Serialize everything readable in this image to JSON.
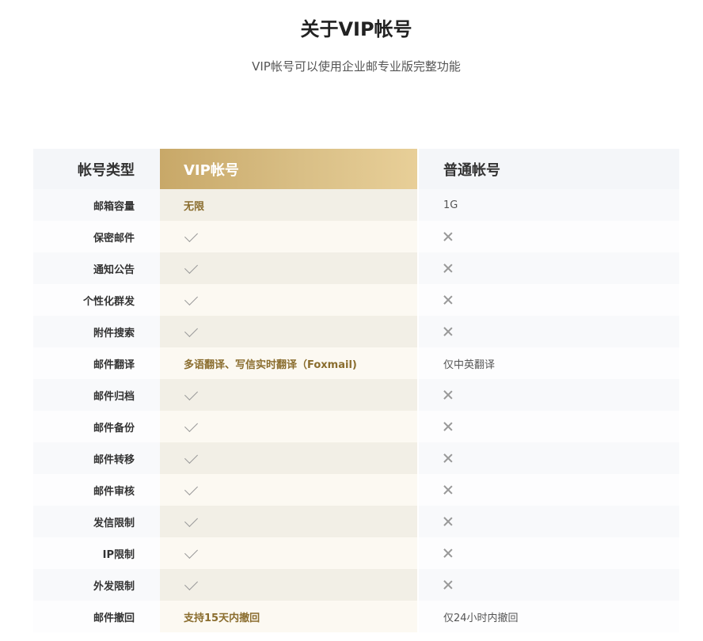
{
  "header": {
    "title": "关于VIP帐号",
    "subtitle": "VIP帐号可以使用企业邮专业版完整功能"
  },
  "table": {
    "columns": [
      "帐号类型",
      "VIP帐号",
      "普通帐号"
    ],
    "rows": [
      {
        "feature": "邮箱容量",
        "vip": "无限",
        "normal": "1G"
      },
      {
        "feature": "保密邮件",
        "vip": "check-icon",
        "normal": "cross-icon"
      },
      {
        "feature": "通知公告",
        "vip": "check-icon",
        "normal": "cross-icon"
      },
      {
        "feature": "个性化群发",
        "vip": "check-icon",
        "normal": "cross-icon"
      },
      {
        "feature": "附件搜索",
        "vip": "check-icon",
        "normal": "cross-icon"
      },
      {
        "feature": "邮件翻译",
        "vip": "多语翻译、写信实时翻译（Foxmail)",
        "normal": "仅中英翻译"
      },
      {
        "feature": "邮件归档",
        "vip": "check-icon",
        "normal": "cross-icon"
      },
      {
        "feature": "邮件备份",
        "vip": "check-icon",
        "normal": "cross-icon"
      },
      {
        "feature": "邮件转移",
        "vip": "check-icon",
        "normal": "cross-icon"
      },
      {
        "feature": "邮件审核",
        "vip": "check-icon",
        "normal": "cross-icon"
      },
      {
        "feature": "发信限制",
        "vip": "check-icon",
        "normal": "cross-icon"
      },
      {
        "feature": "IP限制",
        "vip": "check-icon",
        "normal": "cross-icon"
      },
      {
        "feature": "外发限制",
        "vip": "check-icon",
        "normal": "cross-icon"
      },
      {
        "feature": "邮件撤回",
        "vip": "支持15天内撤回",
        "normal": "仅24小时内撤回"
      }
    ]
  },
  "colors": {
    "vip_header_start": "#c8a868",
    "vip_header_end": "#e8cf98",
    "vip_text": "#8a6d2e"
  }
}
